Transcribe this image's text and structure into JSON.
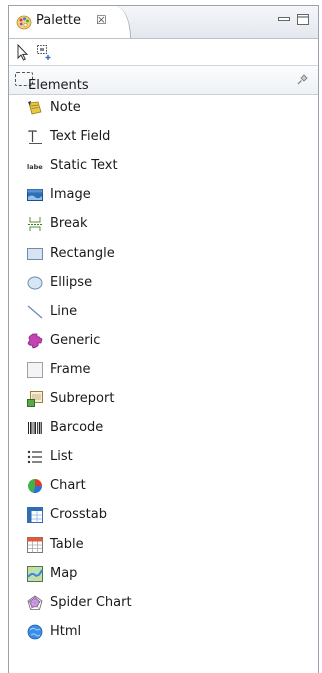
{
  "view": {
    "tab_label": "Palette",
    "tab_close_glyph": "☒",
    "tab_icon": "palette-icon"
  },
  "toolbar": {
    "tools": [
      {
        "name": "selection-tool",
        "icon": "arrow-pointer-icon"
      },
      {
        "name": "marquee-tool",
        "icon": "marquee-icon"
      }
    ]
  },
  "drawer": {
    "label": "Elements",
    "pinned": true
  },
  "items": [
    {
      "label": "Note",
      "icon": "note-icon"
    },
    {
      "label": "Text Field",
      "icon": "text-field-icon"
    },
    {
      "label": "Static Text",
      "icon": "static-text-icon"
    },
    {
      "label": "Image",
      "icon": "image-icon"
    },
    {
      "label": "Break",
      "icon": "break-icon"
    },
    {
      "label": "Rectangle",
      "icon": "rectangle-icon"
    },
    {
      "label": "Ellipse",
      "icon": "ellipse-icon"
    },
    {
      "label": "Line",
      "icon": "line-icon"
    },
    {
      "label": "Generic",
      "icon": "generic-icon"
    },
    {
      "label": "Frame",
      "icon": "frame-icon"
    },
    {
      "label": "Subreport",
      "icon": "subreport-icon"
    },
    {
      "label": "Barcode",
      "icon": "barcode-icon"
    },
    {
      "label": "List",
      "icon": "list-icon"
    },
    {
      "label": "Chart",
      "icon": "chart-icon"
    },
    {
      "label": "Crosstab",
      "icon": "crosstab-icon"
    },
    {
      "label": "Table",
      "icon": "table-icon"
    },
    {
      "label": "Map",
      "icon": "map-icon"
    },
    {
      "label": "Spider Chart",
      "icon": "spider-chart-icon"
    },
    {
      "label": "Html",
      "icon": "html-icon"
    }
  ]
}
